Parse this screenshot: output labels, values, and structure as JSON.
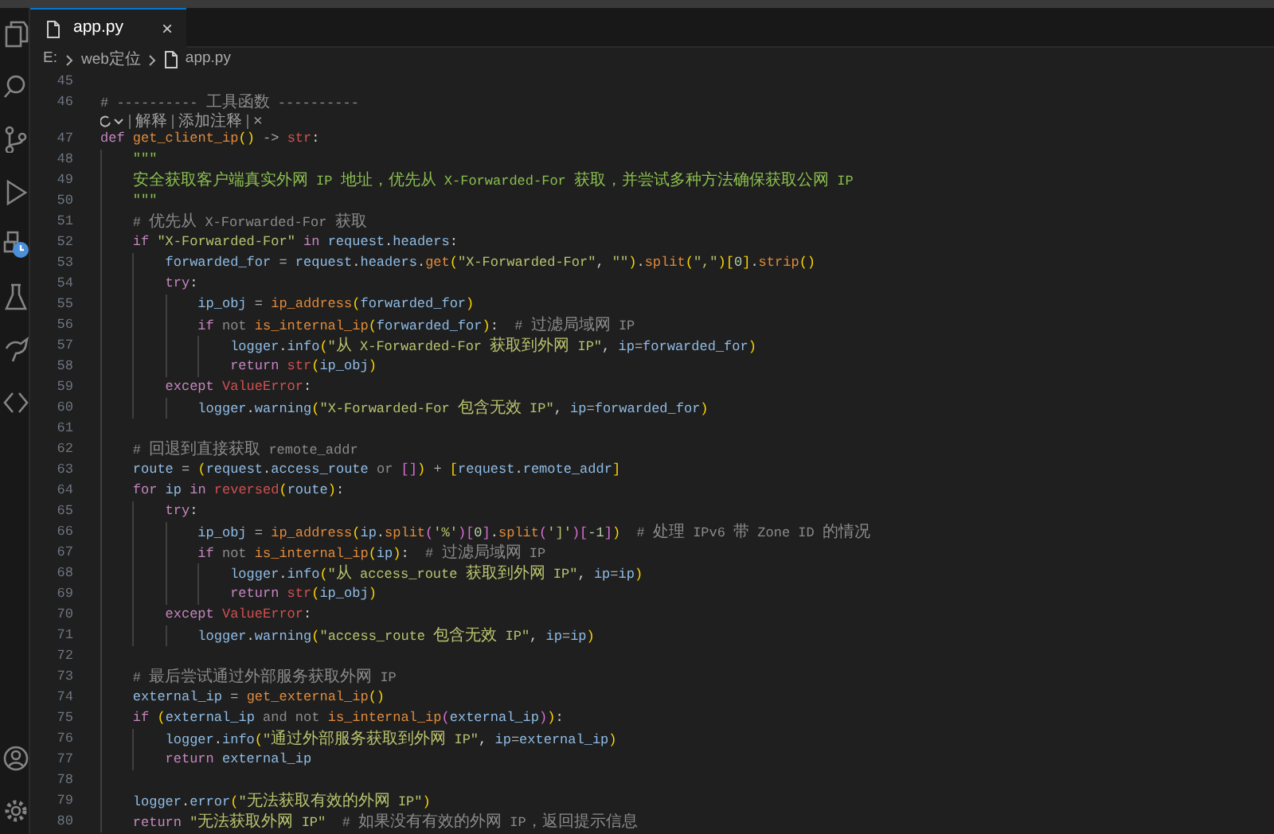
{
  "tabs": [
    {
      "label": "app.py",
      "selected": true,
      "close": "×"
    }
  ],
  "breadcrumb": [
    "E:",
    "web定位",
    "app.py"
  ],
  "lines": [
    {
      "number": "45"
    },
    {
      "number": "46",
      "tokens": [
        {
          "text": "# ---------- 工具函数 ----------",
          "kind": "comment"
        }
      ],
      "codelens": {
        "actions": [
          "解释",
          "添加注释"
        ],
        "close": "×"
      }
    },
    {
      "number": "47",
      "tokens": [
        {
          "text": "def ",
          "kind": "keyword"
        },
        {
          "text": "get_client_ip",
          "kind": "function"
        },
        {
          "text": "()",
          "kind": "paren1"
        },
        {
          "text": " -> ",
          "kind": "operator"
        },
        {
          "text": "str",
          "kind": "builtin"
        },
        {
          "text": ":",
          "kind": "plain"
        }
      ],
      "children": [
        {
          "number": "48",
          "tokens": [
            {
              "text": "\"\"\"",
              "kind": "docstring"
            }
          ]
        },
        {
          "number": "49",
          "tokens": [
            {
              "text": "安全获取客户端真实外网 IP 地址，优先从 X-Forwarded-For 获取，并尝试多种方法确保获取公网 IP",
              "kind": "docstring"
            }
          ]
        },
        {
          "number": "50",
          "tokens": [
            {
              "text": "\"\"\"",
              "kind": "docstring"
            }
          ]
        },
        {
          "number": "51",
          "tokens": [
            {
              "text": "# 优先从 X-Forwarded-For 获取",
              "kind": "comment"
            }
          ]
        },
        {
          "number": "52",
          "tokens": [
            {
              "text": "if ",
              "kind": "keyword"
            },
            {
              "text": "\"X-Forwarded-For\"",
              "kind": "string"
            },
            {
              "text": " in ",
              "kind": "keyword"
            },
            {
              "text": "request",
              "kind": "variable"
            },
            {
              "text": ".",
              "kind": "plain"
            },
            {
              "text": "headers",
              "kind": "variable"
            },
            {
              "text": ":",
              "kind": "plain"
            }
          ],
          "children": [
            {
              "number": "53",
              "tokens": [
                {
                  "text": "forwarded_for",
                  "kind": "variable"
                },
                {
                  "text": " = ",
                  "kind": "operator"
                },
                {
                  "text": "request",
                  "kind": "variable"
                },
                {
                  "text": ".",
                  "kind": "plain"
                },
                {
                  "text": "headers",
                  "kind": "variable"
                },
                {
                  "text": ".",
                  "kind": "plain"
                },
                {
                  "text": "get",
                  "kind": "function"
                },
                {
                  "text": "(",
                  "kind": "paren1"
                },
                {
                  "text": "\"X-Forwarded-For\"",
                  "kind": "string"
                },
                {
                  "text": ", ",
                  "kind": "plain"
                },
                {
                  "text": "\"\"",
                  "kind": "string"
                },
                {
                  "text": ")",
                  "kind": "paren1"
                },
                {
                  "text": ".",
                  "kind": "plain"
                },
                {
                  "text": "split",
                  "kind": "function"
                },
                {
                  "text": "(",
                  "kind": "paren1"
                },
                {
                  "text": "\",\"",
                  "kind": "string"
                },
                {
                  "text": ")[",
                  "kind": "paren1"
                },
                {
                  "text": "0",
                  "kind": "number"
                },
                {
                  "text": "]",
                  "kind": "paren1"
                },
                {
                  "text": ".",
                  "kind": "plain"
                },
                {
                  "text": "strip",
                  "kind": "function"
                },
                {
                  "text": "()",
                  "kind": "paren1"
                }
              ]
            },
            {
              "number": "54",
              "tokens": [
                {
                  "text": "try",
                  "kind": "keyword"
                },
                {
                  "text": ":",
                  "kind": "plain"
                }
              ],
              "children": [
                {
                  "number": "55",
                  "tokens": [
                    {
                      "text": "ip_obj",
                      "kind": "variable"
                    },
                    {
                      "text": " = ",
                      "kind": "operator"
                    },
                    {
                      "text": "ip_address",
                      "kind": "function"
                    },
                    {
                      "text": "(",
                      "kind": "paren1"
                    },
                    {
                      "text": "forwarded_for",
                      "kind": "variable"
                    },
                    {
                      "text": ")",
                      "kind": "paren1"
                    }
                  ]
                },
                {
                  "number": "56",
                  "tokens": [
                    {
                      "text": "if ",
                      "kind": "keyword"
                    },
                    {
                      "text": "not ",
                      "kind": "logic"
                    },
                    {
                      "text": "is_internal_ip",
                      "kind": "function"
                    },
                    {
                      "text": "(",
                      "kind": "paren1"
                    },
                    {
                      "text": "forwarded_for",
                      "kind": "variable"
                    },
                    {
                      "text": ")",
                      "kind": "paren1"
                    },
                    {
                      "text": ":  ",
                      "kind": "plain"
                    },
                    {
                      "text": "# 过滤局域网 IP",
                      "kind": "comment"
                    }
                  ],
                  "children": [
                    {
                      "number": "57",
                      "tokens": [
                        {
                          "text": "logger",
                          "kind": "variable"
                        },
                        {
                          "text": ".",
                          "kind": "plain"
                        },
                        {
                          "text": "info",
                          "kind": "variable"
                        },
                        {
                          "text": "(",
                          "kind": "paren1"
                        },
                        {
                          "text": "\"从 X-Forwarded-For 获取到外网 IP\"",
                          "kind": "string"
                        },
                        {
                          "text": ", ",
                          "kind": "plain"
                        },
                        {
                          "text": "ip",
                          "kind": "variable"
                        },
                        {
                          "text": "=",
                          "kind": "operator"
                        },
                        {
                          "text": "forwarded_for",
                          "kind": "variable"
                        },
                        {
                          "text": ")",
                          "kind": "paren1"
                        }
                      ]
                    },
                    {
                      "number": "58",
                      "tokens": [
                        {
                          "text": "return ",
                          "kind": "keyword"
                        },
                        {
                          "text": "str",
                          "kind": "builtin"
                        },
                        {
                          "text": "(",
                          "kind": "paren1"
                        },
                        {
                          "text": "ip_obj",
                          "kind": "variable"
                        },
                        {
                          "text": ")",
                          "kind": "paren1"
                        }
                      ]
                    }
                  ]
                }
              ]
            },
            {
              "number": "59",
              "tokens": [
                {
                  "text": "except ",
                  "kind": "keyword"
                },
                {
                  "text": "ValueError",
                  "kind": "builtin"
                },
                {
                  "text": ":",
                  "kind": "plain"
                }
              ],
              "children": [
                {
                  "number": "60",
                  "tokens": [
                    {
                      "text": "logger",
                      "kind": "variable"
                    },
                    {
                      "text": ".",
                      "kind": "plain"
                    },
                    {
                      "text": "warning",
                      "kind": "variable"
                    },
                    {
                      "text": "(",
                      "kind": "paren1"
                    },
                    {
                      "text": "\"X-Forwarded-For 包含无效 IP\"",
                      "kind": "string"
                    },
                    {
                      "text": ", ",
                      "kind": "plain"
                    },
                    {
                      "text": "ip",
                      "kind": "variable"
                    },
                    {
                      "text": "=",
                      "kind": "operator"
                    },
                    {
                      "text": "forwarded_for",
                      "kind": "variable"
                    },
                    {
                      "text": ")",
                      "kind": "paren1"
                    }
                  ]
                }
              ]
            }
          ]
        },
        {
          "number": "61"
        },
        {
          "number": "62",
          "tokens": [
            {
              "text": "# 回退到直接获取 remote_addr",
              "kind": "comment"
            }
          ]
        },
        {
          "number": "63",
          "tokens": [
            {
              "text": "route",
              "kind": "variable"
            },
            {
              "text": " = ",
              "kind": "operator"
            },
            {
              "text": "(",
              "kind": "paren1"
            },
            {
              "text": "request",
              "kind": "variable"
            },
            {
              "text": ".",
              "kind": "plain"
            },
            {
              "text": "access_route",
              "kind": "variable"
            },
            {
              "text": " or ",
              "kind": "logic"
            },
            {
              "text": "[]",
              "kind": "paren2"
            },
            {
              "text": ")",
              "kind": "paren1"
            },
            {
              "text": " + ",
              "kind": "operator"
            },
            {
              "text": "[",
              "kind": "paren1"
            },
            {
              "text": "request",
              "kind": "variable"
            },
            {
              "text": ".",
              "kind": "plain"
            },
            {
              "text": "remote_addr",
              "kind": "variable"
            },
            {
              "text": "]",
              "kind": "paren1"
            }
          ]
        },
        {
          "number": "64",
          "tokens": [
            {
              "text": "for ",
              "kind": "keyword"
            },
            {
              "text": "ip",
              "kind": "variable"
            },
            {
              "text": " in ",
              "kind": "keyword"
            },
            {
              "text": "reversed",
              "kind": "builtin"
            },
            {
              "text": "(",
              "kind": "paren1"
            },
            {
              "text": "route",
              "kind": "variable"
            },
            {
              "text": ")",
              "kind": "paren1"
            },
            {
              "text": ":",
              "kind": "plain"
            }
          ],
          "children": [
            {
              "number": "65",
              "tokens": [
                {
                  "text": "try",
                  "kind": "keyword"
                },
                {
                  "text": ":",
                  "kind": "plain"
                }
              ],
              "children": [
                {
                  "number": "66",
                  "tokens": [
                    {
                      "text": "ip_obj",
                      "kind": "variable"
                    },
                    {
                      "text": " = ",
                      "kind": "operator"
                    },
                    {
                      "text": "ip_address",
                      "kind": "function"
                    },
                    {
                      "text": "(",
                      "kind": "paren1"
                    },
                    {
                      "text": "ip",
                      "kind": "variable"
                    },
                    {
                      "text": ".",
                      "kind": "plain"
                    },
                    {
                      "text": "split",
                      "kind": "function"
                    },
                    {
                      "text": "(",
                      "kind": "paren2"
                    },
                    {
                      "text": "'%'",
                      "kind": "string"
                    },
                    {
                      "text": ")[",
                      "kind": "paren2"
                    },
                    {
                      "text": "0",
                      "kind": "number"
                    },
                    {
                      "text": "]",
                      "kind": "paren2"
                    },
                    {
                      "text": ".",
                      "kind": "plain"
                    },
                    {
                      "text": "split",
                      "kind": "function"
                    },
                    {
                      "text": "(",
                      "kind": "paren2"
                    },
                    {
                      "text": "']'",
                      "kind": "string"
                    },
                    {
                      "text": ")[",
                      "kind": "paren2"
                    },
                    {
                      "text": "-1",
                      "kind": "number"
                    },
                    {
                      "text": "]",
                      "kind": "paren2"
                    },
                    {
                      "text": ")  ",
                      "kind": "paren1"
                    },
                    {
                      "text": "# 处理 IPv6 带 Zone ID 的情况",
                      "kind": "comment"
                    }
                  ]
                },
                {
                  "number": "67",
                  "tokens": [
                    {
                      "text": "if ",
                      "kind": "keyword"
                    },
                    {
                      "text": "not ",
                      "kind": "logic"
                    },
                    {
                      "text": "is_internal_ip",
                      "kind": "function"
                    },
                    {
                      "text": "(",
                      "kind": "paren1"
                    },
                    {
                      "text": "ip",
                      "kind": "variable"
                    },
                    {
                      "text": ")",
                      "kind": "paren1"
                    },
                    {
                      "text": ":  ",
                      "kind": "plain"
                    },
                    {
                      "text": "# 过滤局域网 IP",
                      "kind": "comment"
                    }
                  ],
                  "children": [
                    {
                      "number": "68",
                      "tokens": [
                        {
                          "text": "logger",
                          "kind": "variable"
                        },
                        {
                          "text": ".",
                          "kind": "plain"
                        },
                        {
                          "text": "info",
                          "kind": "variable"
                        },
                        {
                          "text": "(",
                          "kind": "paren1"
                        },
                        {
                          "text": "\"从 access_route 获取到外网 IP\"",
                          "kind": "string"
                        },
                        {
                          "text": ", ",
                          "kind": "plain"
                        },
                        {
                          "text": "ip",
                          "kind": "variable"
                        },
                        {
                          "text": "=",
                          "kind": "operator"
                        },
                        {
                          "text": "ip",
                          "kind": "variable"
                        },
                        {
                          "text": ")",
                          "kind": "paren1"
                        }
                      ]
                    },
                    {
                      "number": "69",
                      "tokens": [
                        {
                          "text": "return ",
                          "kind": "keyword"
                        },
                        {
                          "text": "str",
                          "kind": "builtin"
                        },
                        {
                          "text": "(",
                          "kind": "paren1"
                        },
                        {
                          "text": "ip_obj",
                          "kind": "variable"
                        },
                        {
                          "text": ")",
                          "kind": "paren1"
                        }
                      ]
                    }
                  ]
                }
              ]
            },
            {
              "number": "70",
              "tokens": [
                {
                  "text": "except ",
                  "kind": "keyword"
                },
                {
                  "text": "ValueError",
                  "kind": "builtin"
                },
                {
                  "text": ":",
                  "kind": "plain"
                }
              ],
              "children": [
                {
                  "number": "71",
                  "tokens": [
                    {
                      "text": "logger",
                      "kind": "variable"
                    },
                    {
                      "text": ".",
                      "kind": "plain"
                    },
                    {
                      "text": "warning",
                      "kind": "variable"
                    },
                    {
                      "text": "(",
                      "kind": "paren1"
                    },
                    {
                      "text": "\"access_route 包含无效 IP\"",
                      "kind": "string"
                    },
                    {
                      "text": ", ",
                      "kind": "plain"
                    },
                    {
                      "text": "ip",
                      "kind": "variable"
                    },
                    {
                      "text": "=",
                      "kind": "operator"
                    },
                    {
                      "text": "ip",
                      "kind": "variable"
                    },
                    {
                      "text": ")",
                      "kind": "paren1"
                    }
                  ]
                }
              ]
            }
          ]
        },
        {
          "number": "72"
        },
        {
          "number": "73",
          "tokens": [
            {
              "text": "# 最后尝试通过外部服务获取外网 IP",
              "kind": "comment"
            }
          ]
        },
        {
          "number": "74",
          "tokens": [
            {
              "text": "external_ip",
              "kind": "variable"
            },
            {
              "text": " = ",
              "kind": "operator"
            },
            {
              "text": "get_external_ip",
              "kind": "function"
            },
            {
              "text": "()",
              "kind": "paren1"
            }
          ]
        },
        {
          "number": "75",
          "tokens": [
            {
              "text": "if ",
              "kind": "keyword"
            },
            {
              "text": "(",
              "kind": "paren1"
            },
            {
              "text": "external_ip",
              "kind": "variable"
            },
            {
              "text": " and not ",
              "kind": "logic"
            },
            {
              "text": "is_internal_ip",
              "kind": "function"
            },
            {
              "text": "(",
              "kind": "paren2"
            },
            {
              "text": "external_ip",
              "kind": "variable"
            },
            {
              "text": ")",
              "kind": "paren2"
            },
            {
              "text": ")",
              "kind": "paren1"
            },
            {
              "text": ":",
              "kind": "plain"
            }
          ],
          "children": [
            {
              "number": "76",
              "tokens": [
                {
                  "text": "logger",
                  "kind": "variable"
                },
                {
                  "text": ".",
                  "kind": "plain"
                },
                {
                  "text": "info",
                  "kind": "variable"
                },
                {
                  "text": "(",
                  "kind": "paren1"
                },
                {
                  "text": "\"通过外部服务获取到外网 IP\"",
                  "kind": "string"
                },
                {
                  "text": ", ",
                  "kind": "plain"
                },
                {
                  "text": "ip",
                  "kind": "variable"
                },
                {
                  "text": "=",
                  "kind": "operator"
                },
                {
                  "text": "external_ip",
                  "kind": "variable"
                },
                {
                  "text": ")",
                  "kind": "paren1"
                }
              ]
            },
            {
              "number": "77",
              "tokens": [
                {
                  "text": "return ",
                  "kind": "keyword"
                },
                {
                  "text": "external_ip",
                  "kind": "variable"
                }
              ]
            }
          ]
        },
        {
          "number": "78"
        },
        {
          "number": "79",
          "tokens": [
            {
              "text": "logger",
              "kind": "variable"
            },
            {
              "text": ".",
              "kind": "plain"
            },
            {
              "text": "error",
              "kind": "variable"
            },
            {
              "text": "(",
              "kind": "paren1"
            },
            {
              "text": "\"无法获取有效的外网 IP\"",
              "kind": "string"
            },
            {
              "text": ")",
              "kind": "paren1"
            }
          ]
        },
        {
          "number": "80",
          "tokens": [
            {
              "text": "return ",
              "kind": "keyword"
            },
            {
              "text": "\"无法获取外网 IP\"",
              "kind": "string"
            },
            {
              "text": "  # 如果没有有效的外网 IP，返回提示信息",
              "kind": "comment"
            }
          ]
        }
      ]
    }
  ]
}
